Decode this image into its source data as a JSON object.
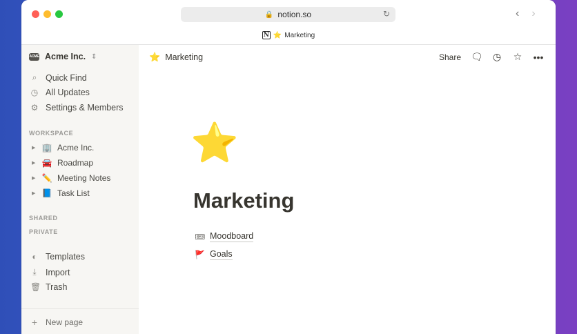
{
  "browser": {
    "url": "notion.so",
    "tab_title": "Marketing",
    "tab_icon": "⭐"
  },
  "sidebar": {
    "workspace_name": "Acme Inc.",
    "workspace_badge": "ACME",
    "top_items": [
      {
        "label": "Quick Find",
        "icon": "search-icon",
        "glyph": "⌕"
      },
      {
        "label": "All Updates",
        "icon": "clock-icon",
        "glyph": "◷"
      },
      {
        "label": "Settings & Members",
        "icon": "gear-icon",
        "glyph": "⚙"
      }
    ],
    "workspace_section": "WORKSPACE",
    "pages": [
      {
        "label": "Acme Inc.",
        "emoji": "🏢"
      },
      {
        "label": "Roadmap",
        "emoji": "🚘"
      },
      {
        "label": "Meeting Notes",
        "emoji": "✏️"
      },
      {
        "label": "Task List",
        "emoji": "📘"
      }
    ],
    "shared_section": "SHARED",
    "private_section": "PRIVATE",
    "bottom_items": [
      {
        "label": "Templates",
        "icon": "shapes-icon",
        "glyph": "◐"
      },
      {
        "label": "Import",
        "icon": "download-icon",
        "glyph": "⤓"
      },
      {
        "label": "Trash",
        "icon": "trash-icon",
        "glyph": "🗑"
      }
    ],
    "new_page": "New page"
  },
  "topbar": {
    "breadcrumb": "Marketing",
    "breadcrumb_icon": "⭐",
    "share": "Share"
  },
  "page": {
    "icon": "⭐",
    "title": "Marketing",
    "subpages": [
      {
        "label": "Moodboard",
        "emoji": "🎟"
      },
      {
        "label": "Goals",
        "emoji": "🚩"
      }
    ]
  },
  "colors": {
    "sidebar_bg": "#f7f6f3",
    "text": "#37352f",
    "accent_star": "#f6b820"
  }
}
